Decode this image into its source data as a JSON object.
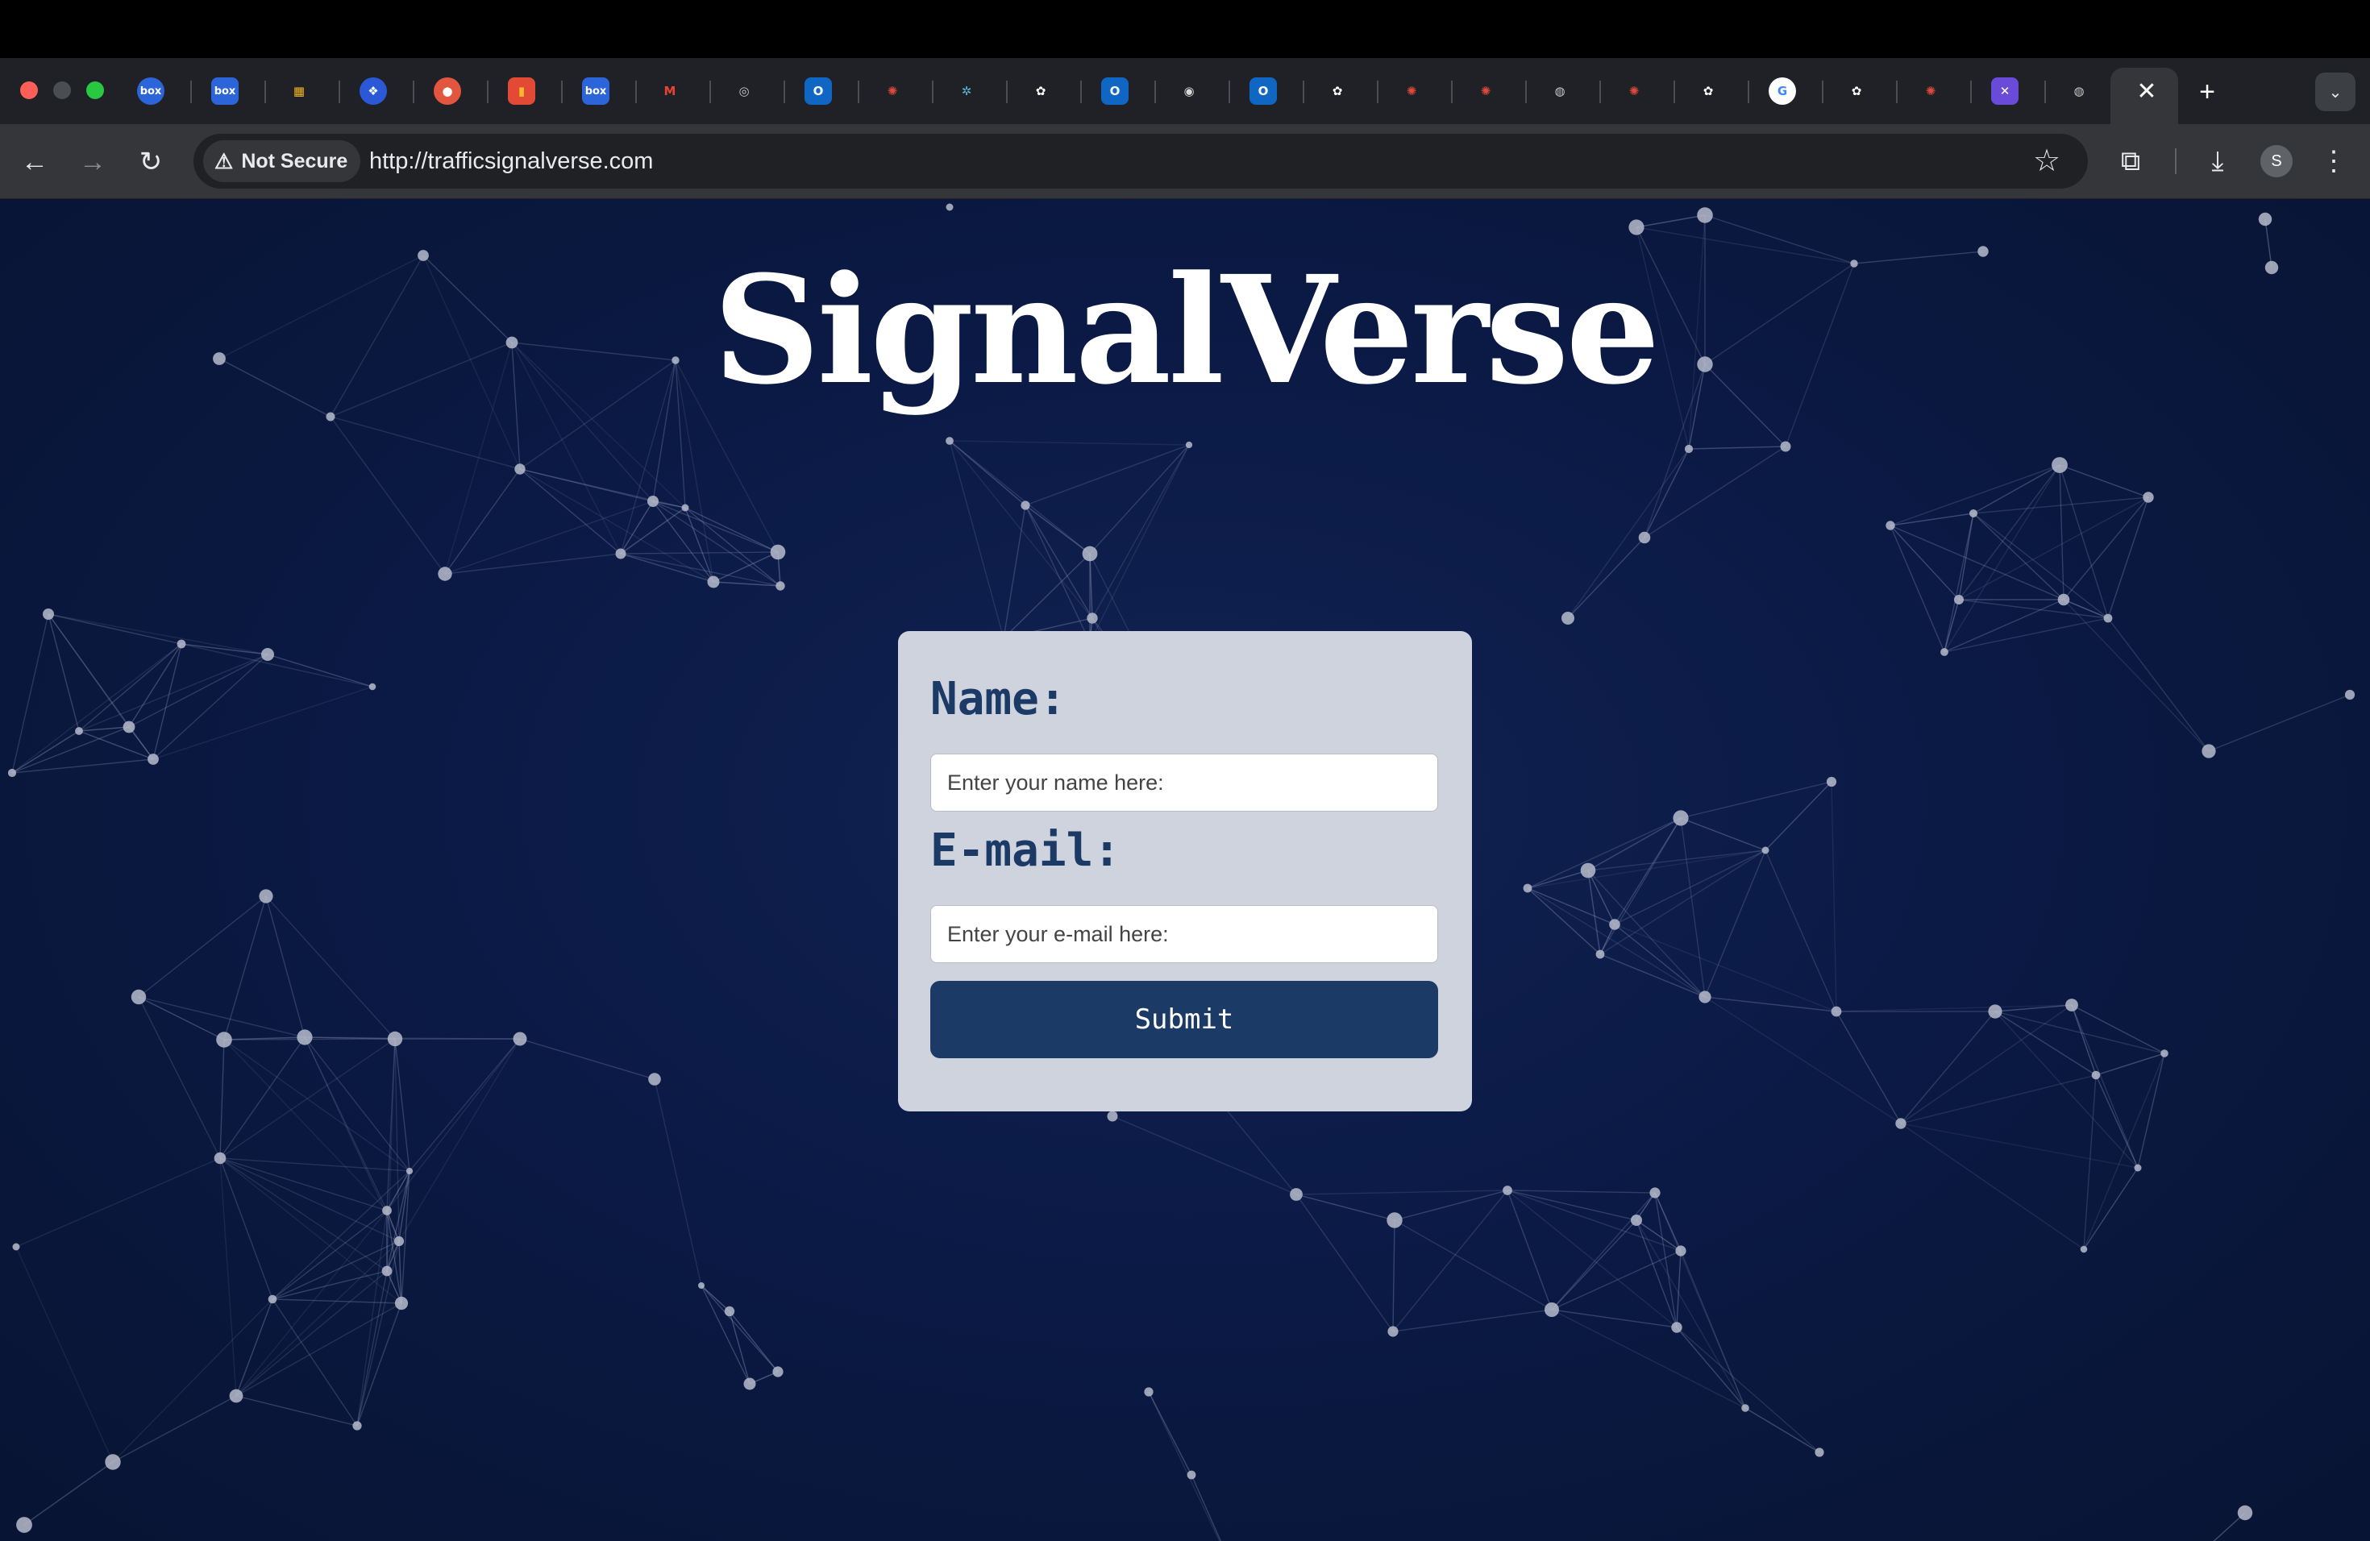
{
  "browser": {
    "security_label": "Not Secure",
    "url": "http://trafficsignalverse.com",
    "profile_initial": "S",
    "tab_close_glyph": "✕",
    "new_tab_glyph": "+",
    "tab_search_glyph": "⌄",
    "favicons": [
      {
        "name": "box-favicon",
        "glyph": "box",
        "bg": "#2c64d9",
        "fg": "#ffffff",
        "circle": true
      },
      {
        "name": "box-favicon",
        "glyph": "box",
        "bg": "#2c64d9",
        "fg": "#ffffff",
        "circle": false
      },
      {
        "name": "microsoft-favicon",
        "glyph": "▦",
        "bg": "#1f2126",
        "fg": "#f3b623",
        "circle": false
      },
      {
        "name": "dropbox-favicon",
        "glyph": "❖",
        "bg": "#2b58d6",
        "fg": "#ffffff",
        "circle": true
      },
      {
        "name": "maps-pin-favicon",
        "glyph": "●",
        "bg": "#e2553f",
        "fg": "#ffffff",
        "circle": true
      },
      {
        "name": "slides-favicon",
        "glyph": "▮",
        "bg": "#e34a35",
        "fg": "#f6b92b",
        "circle": false
      },
      {
        "name": "box-favicon",
        "glyph": "box",
        "bg": "#2c64d9",
        "fg": "#ffffff",
        "circle": false
      },
      {
        "name": "gmail-favicon",
        "glyph": "M",
        "bg": "#1f2126",
        "fg": "#ea4335",
        "circle": false
      },
      {
        "name": "globe-favicon",
        "glyph": "◎",
        "bg": "#1f2126",
        "fg": "#c8c8c8",
        "circle": true
      },
      {
        "name": "outlook-favicon",
        "glyph": "O",
        "bg": "#1066c3",
        "fg": "#ffffff",
        "circle": false
      },
      {
        "name": "asterisk-favicon",
        "glyph": "✺",
        "bg": "#1f2126",
        "fg": "#e04a3a",
        "circle": true
      },
      {
        "name": "perplexity-favicon",
        "glyph": "✲",
        "bg": "#1f2126",
        "fg": "#58b5d6",
        "circle": false
      },
      {
        "name": "openai-favicon",
        "glyph": "✿",
        "bg": "#1f2126",
        "fg": "#ffffff",
        "circle": true
      },
      {
        "name": "outlook-favicon",
        "glyph": "O",
        "bg": "#1066c3",
        "fg": "#ffffff",
        "circle": false
      },
      {
        "name": "chrome-favicon",
        "glyph": "◉",
        "bg": "#1f2126",
        "fg": "#d8d8d8",
        "circle": true
      },
      {
        "name": "outlook-favicon",
        "glyph": "O",
        "bg": "#1066c3",
        "fg": "#ffffff",
        "circle": false
      },
      {
        "name": "openai-favicon",
        "glyph": "✿",
        "bg": "#1f2126",
        "fg": "#ffffff",
        "circle": true
      },
      {
        "name": "asterisk-favicon",
        "glyph": "✺",
        "bg": "#1f2126",
        "fg": "#e04a3a",
        "circle": true
      },
      {
        "name": "asterisk-favicon",
        "glyph": "✺",
        "bg": "#1f2126",
        "fg": "#e04a3a",
        "circle": true
      },
      {
        "name": "globe-favicon",
        "glyph": "◍",
        "bg": "#1f2126",
        "fg": "#c8c8c8",
        "circle": true
      },
      {
        "name": "asterisk-favicon",
        "glyph": "✺",
        "bg": "#1f2126",
        "fg": "#e04a3a",
        "circle": true
      },
      {
        "name": "openai-favicon",
        "glyph": "✿",
        "bg": "#1f2126",
        "fg": "#ffffff",
        "circle": true
      },
      {
        "name": "google-favicon",
        "glyph": "G",
        "bg": "#ffffff",
        "fg": "#4285f4",
        "circle": true
      },
      {
        "name": "openai-favicon",
        "glyph": "✿",
        "bg": "#1f2126",
        "fg": "#ffffff",
        "circle": true
      },
      {
        "name": "asterisk-favicon",
        "glyph": "✺",
        "bg": "#1f2126",
        "fg": "#e04a3a",
        "circle": true
      },
      {
        "name": "tools-favicon",
        "glyph": "✕",
        "bg": "#6a4ad8",
        "fg": "#ffffff",
        "circle": false
      },
      {
        "name": "globe-favicon",
        "glyph": "◍",
        "bg": "#1f2126",
        "fg": "#c8c8c8",
        "circle": true
      }
    ]
  },
  "page": {
    "title": "SignalVerse",
    "form": {
      "name_label": "Name:",
      "name_placeholder": "Enter your name here:",
      "email_label": "E-mail:",
      "email_placeholder": "Enter your e-mail here:",
      "submit_label": "Submit"
    }
  }
}
